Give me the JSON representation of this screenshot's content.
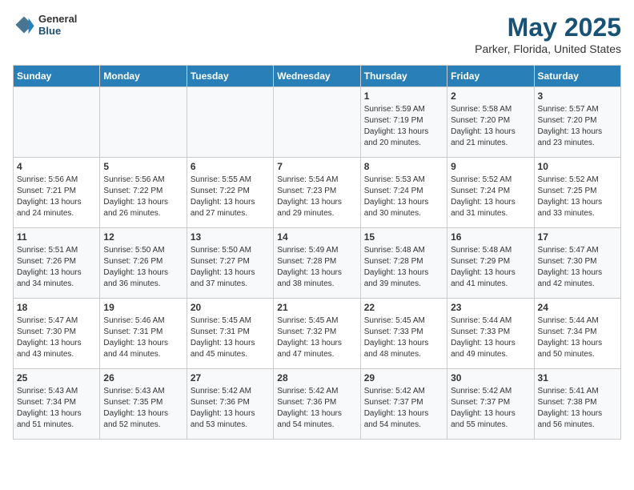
{
  "header": {
    "logo_general": "General",
    "logo_blue": "Blue",
    "title": "May 2025",
    "subtitle": "Parker, Florida, United States"
  },
  "days_of_week": [
    "Sunday",
    "Monday",
    "Tuesday",
    "Wednesday",
    "Thursday",
    "Friday",
    "Saturday"
  ],
  "weeks": [
    [
      {
        "day": "",
        "info": ""
      },
      {
        "day": "",
        "info": ""
      },
      {
        "day": "",
        "info": ""
      },
      {
        "day": "",
        "info": ""
      },
      {
        "day": "1",
        "info": "Sunrise: 5:59 AM\nSunset: 7:19 PM\nDaylight: 13 hours and 20 minutes."
      },
      {
        "day": "2",
        "info": "Sunrise: 5:58 AM\nSunset: 7:20 PM\nDaylight: 13 hours and 21 minutes."
      },
      {
        "day": "3",
        "info": "Sunrise: 5:57 AM\nSunset: 7:20 PM\nDaylight: 13 hours and 23 minutes."
      }
    ],
    [
      {
        "day": "4",
        "info": "Sunrise: 5:56 AM\nSunset: 7:21 PM\nDaylight: 13 hours and 24 minutes."
      },
      {
        "day": "5",
        "info": "Sunrise: 5:56 AM\nSunset: 7:22 PM\nDaylight: 13 hours and 26 minutes."
      },
      {
        "day": "6",
        "info": "Sunrise: 5:55 AM\nSunset: 7:22 PM\nDaylight: 13 hours and 27 minutes."
      },
      {
        "day": "7",
        "info": "Sunrise: 5:54 AM\nSunset: 7:23 PM\nDaylight: 13 hours and 29 minutes."
      },
      {
        "day": "8",
        "info": "Sunrise: 5:53 AM\nSunset: 7:24 PM\nDaylight: 13 hours and 30 minutes."
      },
      {
        "day": "9",
        "info": "Sunrise: 5:52 AM\nSunset: 7:24 PM\nDaylight: 13 hours and 31 minutes."
      },
      {
        "day": "10",
        "info": "Sunrise: 5:52 AM\nSunset: 7:25 PM\nDaylight: 13 hours and 33 minutes."
      }
    ],
    [
      {
        "day": "11",
        "info": "Sunrise: 5:51 AM\nSunset: 7:26 PM\nDaylight: 13 hours and 34 minutes."
      },
      {
        "day": "12",
        "info": "Sunrise: 5:50 AM\nSunset: 7:26 PM\nDaylight: 13 hours and 36 minutes."
      },
      {
        "day": "13",
        "info": "Sunrise: 5:50 AM\nSunset: 7:27 PM\nDaylight: 13 hours and 37 minutes."
      },
      {
        "day": "14",
        "info": "Sunrise: 5:49 AM\nSunset: 7:28 PM\nDaylight: 13 hours and 38 minutes."
      },
      {
        "day": "15",
        "info": "Sunrise: 5:48 AM\nSunset: 7:28 PM\nDaylight: 13 hours and 39 minutes."
      },
      {
        "day": "16",
        "info": "Sunrise: 5:48 AM\nSunset: 7:29 PM\nDaylight: 13 hours and 41 minutes."
      },
      {
        "day": "17",
        "info": "Sunrise: 5:47 AM\nSunset: 7:30 PM\nDaylight: 13 hours and 42 minutes."
      }
    ],
    [
      {
        "day": "18",
        "info": "Sunrise: 5:47 AM\nSunset: 7:30 PM\nDaylight: 13 hours and 43 minutes."
      },
      {
        "day": "19",
        "info": "Sunrise: 5:46 AM\nSunset: 7:31 PM\nDaylight: 13 hours and 44 minutes."
      },
      {
        "day": "20",
        "info": "Sunrise: 5:45 AM\nSunset: 7:31 PM\nDaylight: 13 hours and 45 minutes."
      },
      {
        "day": "21",
        "info": "Sunrise: 5:45 AM\nSunset: 7:32 PM\nDaylight: 13 hours and 47 minutes."
      },
      {
        "day": "22",
        "info": "Sunrise: 5:45 AM\nSunset: 7:33 PM\nDaylight: 13 hours and 48 minutes."
      },
      {
        "day": "23",
        "info": "Sunrise: 5:44 AM\nSunset: 7:33 PM\nDaylight: 13 hours and 49 minutes."
      },
      {
        "day": "24",
        "info": "Sunrise: 5:44 AM\nSunset: 7:34 PM\nDaylight: 13 hours and 50 minutes."
      }
    ],
    [
      {
        "day": "25",
        "info": "Sunrise: 5:43 AM\nSunset: 7:34 PM\nDaylight: 13 hours and 51 minutes."
      },
      {
        "day": "26",
        "info": "Sunrise: 5:43 AM\nSunset: 7:35 PM\nDaylight: 13 hours and 52 minutes."
      },
      {
        "day": "27",
        "info": "Sunrise: 5:42 AM\nSunset: 7:36 PM\nDaylight: 13 hours and 53 minutes."
      },
      {
        "day": "28",
        "info": "Sunrise: 5:42 AM\nSunset: 7:36 PM\nDaylight: 13 hours and 54 minutes."
      },
      {
        "day": "29",
        "info": "Sunrise: 5:42 AM\nSunset: 7:37 PM\nDaylight: 13 hours and 54 minutes."
      },
      {
        "day": "30",
        "info": "Sunrise: 5:42 AM\nSunset: 7:37 PM\nDaylight: 13 hours and 55 minutes."
      },
      {
        "day": "31",
        "info": "Sunrise: 5:41 AM\nSunset: 7:38 PM\nDaylight: 13 hours and 56 minutes."
      }
    ]
  ]
}
